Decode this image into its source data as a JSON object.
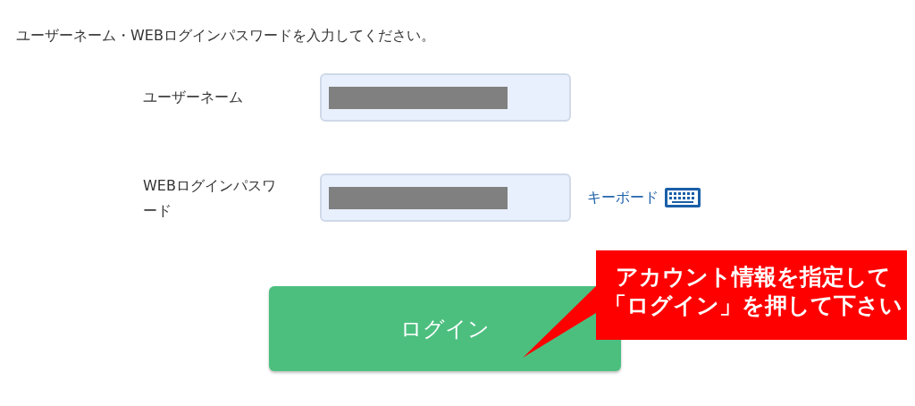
{
  "instruction": "ユーザーネーム・WEBログインパスワードを入力してください。",
  "fields": [
    {
      "label": "ユーザーネーム",
      "masked": true
    },
    {
      "label": "WEBログインパスワード",
      "masked": true
    }
  ],
  "keyboard_link": "キーボード",
  "login_button": "ログイン",
  "callout": {
    "lines": [
      "アカウント情報を指定して",
      "「ログイン」を押して下さい"
    ]
  }
}
